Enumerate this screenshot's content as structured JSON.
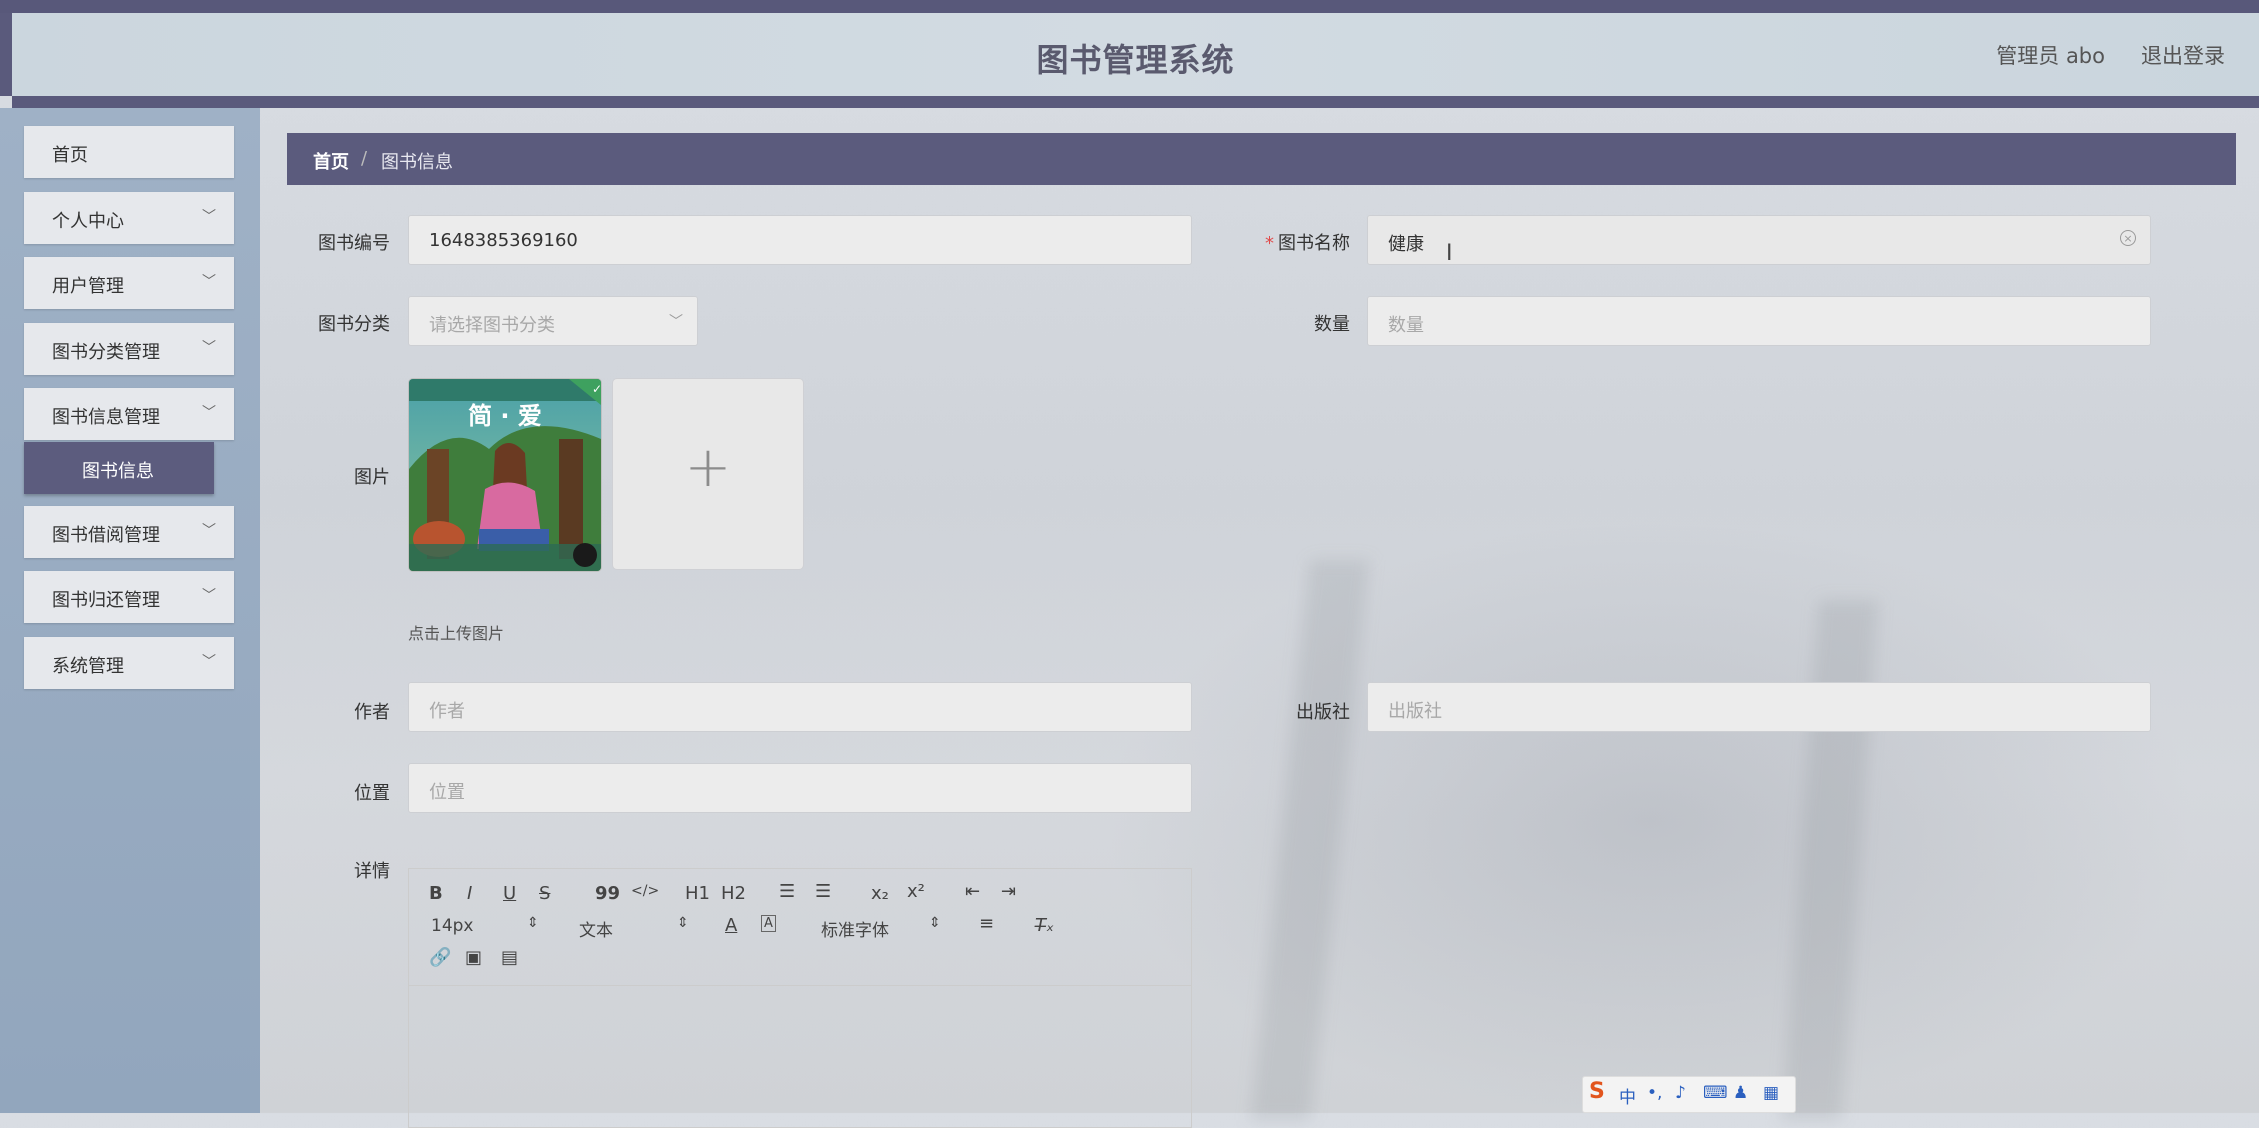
{
  "app": {
    "title": "图书管理系统",
    "admin_label": "管理员 abo",
    "logout_label": "退出登录"
  },
  "sidebar": {
    "items": [
      {
        "label": "首页"
      },
      {
        "label": "个人中心"
      },
      {
        "label": "用户管理"
      },
      {
        "label": "图书分类管理"
      },
      {
        "label": "图书信息管理"
      },
      {
        "label": "图书借阅管理"
      },
      {
        "label": "图书归还管理"
      },
      {
        "label": "系统管理"
      }
    ],
    "sub_active": "图书信息"
  },
  "breadcrumb": {
    "home": "首页",
    "separator": "/",
    "current": "图书信息"
  },
  "form": {
    "book_no": {
      "label": "图书编号",
      "value": "1648385369160"
    },
    "book_name": {
      "label": "图书名称",
      "required_mark": "*",
      "value": "健康"
    },
    "category": {
      "label": "图书分类",
      "placeholder": "请选择图书分类"
    },
    "quantity": {
      "label": "数量",
      "placeholder": "数量"
    },
    "image": {
      "label": "图片",
      "hint": "点击上传图片",
      "cover_title": "简·爱"
    },
    "author": {
      "label": "作者",
      "placeholder": "作者"
    },
    "publisher": {
      "label": "出版社",
      "placeholder": "出版社"
    },
    "location": {
      "label": "位置",
      "placeholder": "位置"
    },
    "detail": {
      "label": "详情"
    }
  },
  "editor": {
    "font_size": "14px",
    "text_type": "文本",
    "font_family": "标准字体",
    "buttons": [
      "B",
      "I",
      "U",
      "S",
      "99",
      "</>",
      "H1",
      "H2"
    ]
  },
  "ime": {
    "label": "中"
  },
  "colors": {
    "accent": "#5b5b7d",
    "required": "#e04a4a",
    "sidebar_bg": "#9fb1c6"
  }
}
